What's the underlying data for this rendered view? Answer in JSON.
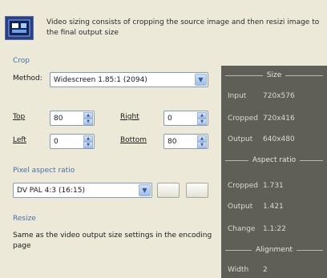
{
  "header": {
    "icon": "video-sizing-icon",
    "description": "Video sizing consists of cropping the source image and then resizi image to the final output size"
  },
  "crop": {
    "group_label": "Crop",
    "method_label": "Method:",
    "method_value": "Widescreen 1.85:1 (2094)",
    "top_label": "Top",
    "top_value": "80",
    "right_label": "Right",
    "right_value": "0",
    "left_label": "Left",
    "left_value": "0",
    "bottom_label": "Bottom",
    "bottom_value": "80"
  },
  "pixel_aspect": {
    "group_label": "Pixel aspect ratio",
    "value": "DV PAL 4:3 (16:15)"
  },
  "resize": {
    "group_label": "Resize",
    "note": "Same as the video output size settings in the encoding page"
  },
  "info_panel": {
    "size_heading": "Size",
    "input_label": "Input",
    "input_value": "720x576",
    "cropped_label": "Cropped",
    "cropped_value": "720x416",
    "output_label": "Output",
    "output_value": "640x480",
    "aspect_heading": "Aspect ratio",
    "aspect_cropped_label": "Cropped",
    "aspect_cropped_value": "1.731",
    "aspect_output_label": "Output",
    "aspect_output_value": "1.421",
    "change_label": "Change",
    "change_value": "1.1:22",
    "alignment_heading": "Alignment",
    "width_label": "Width",
    "width_value": "2"
  },
  "colors": {
    "panel_bg": "#5f5e57",
    "group_label": "#4b6fa8",
    "dialog_bg": "#ece9d8"
  }
}
